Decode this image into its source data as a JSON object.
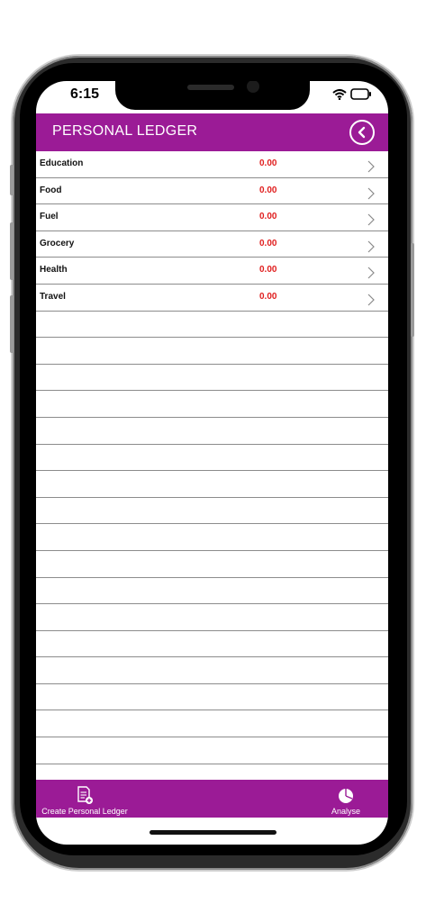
{
  "status_bar": {
    "time": "6:15"
  },
  "header": {
    "title": "PERSONAL LEDGER",
    "back_icon": "chevron-left-circle-icon"
  },
  "ledger": {
    "rows": [
      {
        "label": "Education",
        "amount": "0.00"
      },
      {
        "label": "Food",
        "amount": "0.00"
      },
      {
        "label": "Fuel",
        "amount": "0.00"
      },
      {
        "label": "Grocery",
        "amount": "0.00"
      },
      {
        "label": "Health",
        "amount": "0.00"
      },
      {
        "label": "Travel",
        "amount": "0.00"
      }
    ],
    "empty_row_count": 17
  },
  "bottom_bar": {
    "create_label": "Create Personal Ledger",
    "create_icon": "document-add-icon",
    "analyse_label": "Analyse",
    "analyse_icon": "pie-chart-icon"
  },
  "colors": {
    "accent": "#9b1b96",
    "amount": "#e02020"
  }
}
